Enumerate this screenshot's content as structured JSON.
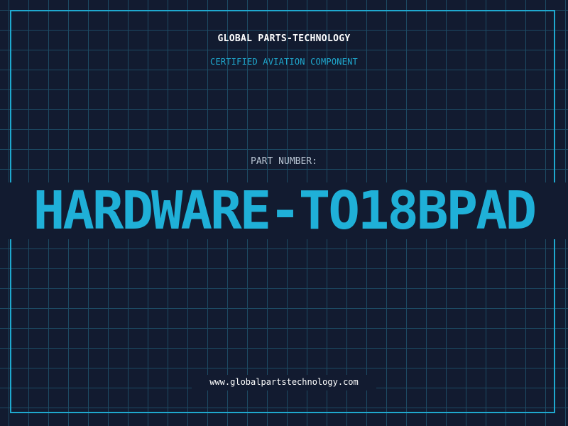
{
  "header": {
    "company": "GLOBAL PARTS-TECHNOLOGY",
    "tagline": "CERTIFIED AVIATION COMPONENT"
  },
  "part": {
    "label": "PART NUMBER:",
    "number": "HARDWARE-TO18BPAD"
  },
  "footer": {
    "url": "www.globalpartstechnology.com"
  },
  "colors": {
    "background": "#121b30",
    "grid": "#1d4a63",
    "accent": "#1fa9cf",
    "text": "#ffffff"
  }
}
